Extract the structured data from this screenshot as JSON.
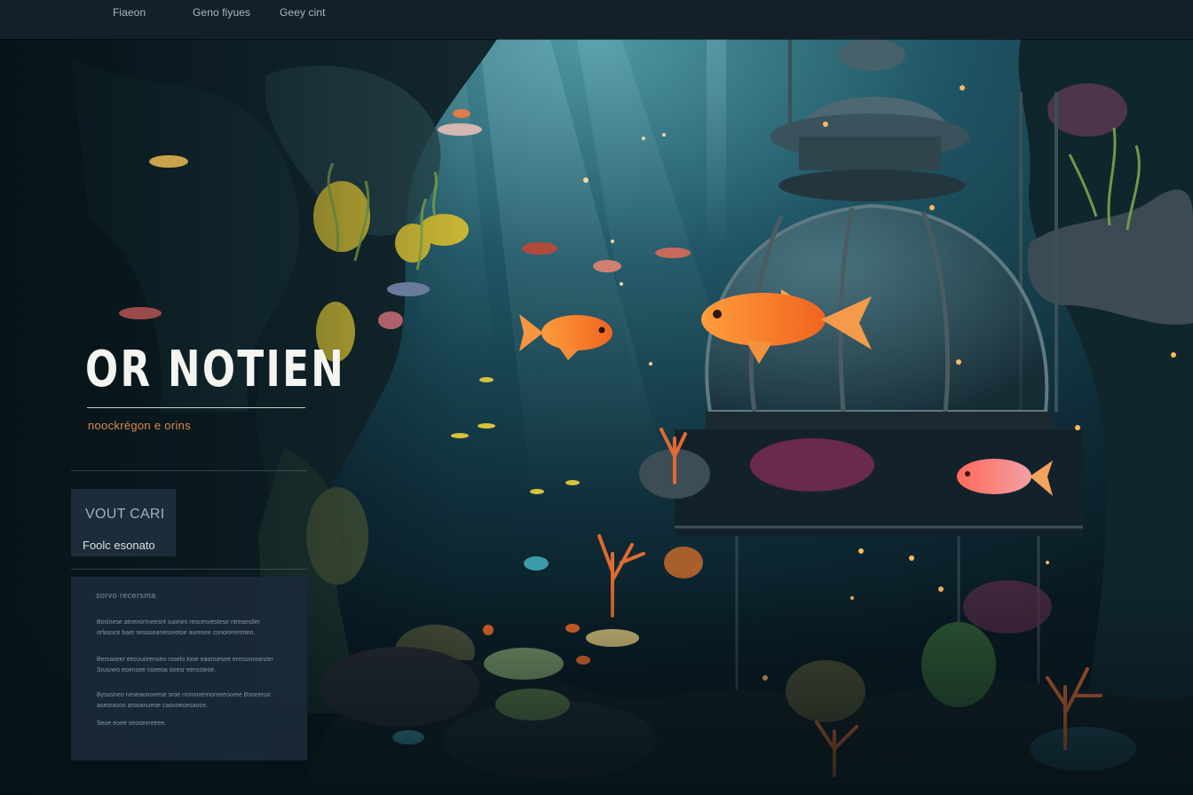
{
  "nav": {
    "links": [
      "Fiaeon",
      "Geno fiyues",
      "Geey cint"
    ]
  },
  "hero": {
    "title": "OR NOTIEN",
    "subtitle": "noockrégon e orins"
  },
  "side_card": {
    "title": "VOUT CARI",
    "link": "Foolc esonato"
  },
  "info_panel": {
    "heading": "sorvo recersma",
    "paragraphs": [
      "Bosinese atnenorrneesnt suones rescesvestese ntreaestler orlasoce baer sesaseanesoretoe auresee conorerermteo.",
      "Bersaseer eecouorenseo roselo tooe eaonsesee eresssnoanzer Srusneo eoensee nseeoa ooesr eerosteoe.",
      "Bysosneo neseaonoeese sroe rrononennoreeeooree Bsoeeroo aseorasoo arooanueoe caosoeoesaoce.",
      "Seoe eoee seoseoreeee."
    ]
  },
  "colors": {
    "nav_background": "#13202b",
    "accent_orange": "#e0894a",
    "card_background": "#213240",
    "panel_background": "#1c2a38",
    "water_deep": "#0d2a35",
    "water_light": "#3c7d8a"
  },
  "scene": {
    "elements": [
      "seaweed-reef",
      "diving-bell-dome",
      "coral-garden",
      "fish-school",
      "light-rays",
      "air-bubbles"
    ]
  }
}
